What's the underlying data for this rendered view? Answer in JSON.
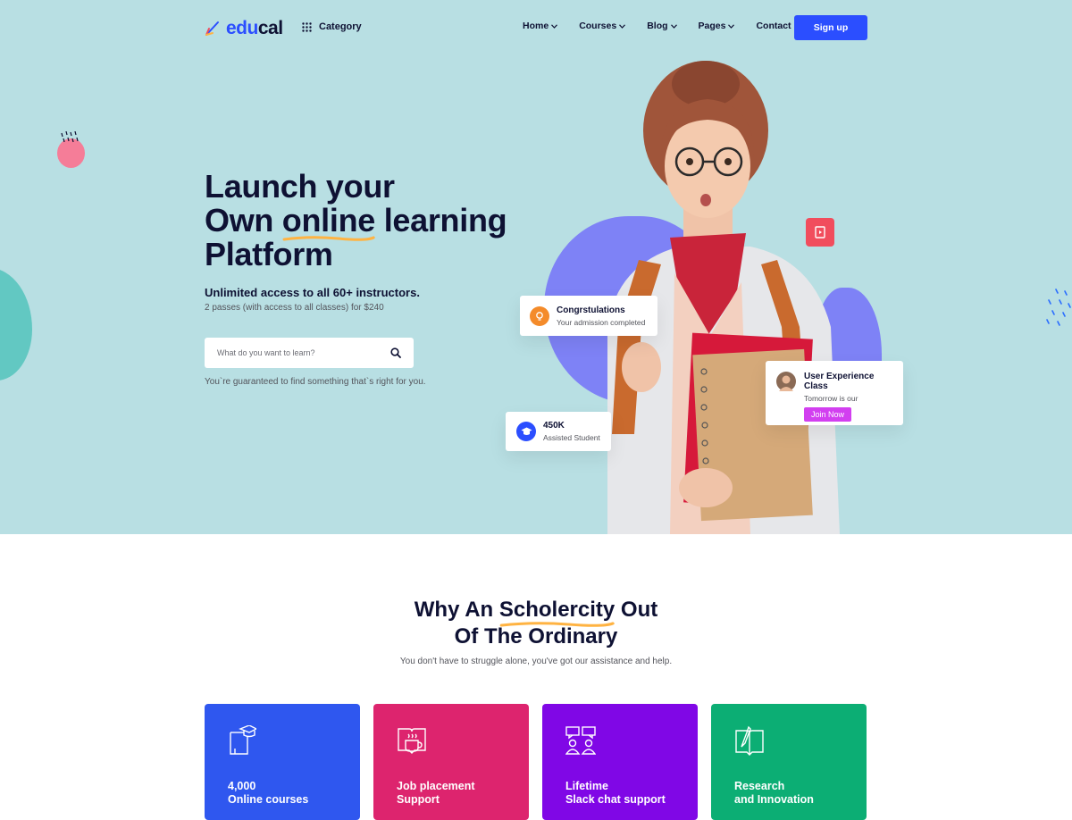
{
  "header": {
    "logo_part1": "edu",
    "logo_part2": "cal",
    "category_label": "Category",
    "nav": [
      "Home",
      "Courses",
      "Blog",
      "Pages",
      "Contact"
    ],
    "signup_label": "Sign up"
  },
  "hero": {
    "title_line1": "Launch your",
    "title_own": "Own ",
    "title_highlight": "online",
    "title_rest": " learning",
    "title_line3": "Platform",
    "subtitle": "Unlimited access to all 60+ instructors.",
    "note": "2 passes (with access to all classes) for $240",
    "search_placeholder": "What do you want to learn?",
    "guarantee": "You`re guaranteed to find something that`s right for you."
  },
  "cards": {
    "congrats_title": "Congrstulations",
    "congrats_text": "Your admission completed",
    "ux_title": "User Experience Class",
    "ux_text": "Tomorrow is our",
    "ux_button": "Join Now",
    "students_count": "450K",
    "students_text": "Assisted Student"
  },
  "why": {
    "title_pre": "Why An ",
    "title_highlight": "Scholercity",
    "title_post": " Out",
    "title_line2": "Of The Ordinary",
    "subtitle": "You don't have to struggle alone, you've got our assistance and help."
  },
  "features": [
    {
      "title": "4,000\nOnline courses",
      "color": "#2f57ef",
      "icon": "graduation-book-icon"
    },
    {
      "title": "Job placement\nSupport",
      "color": "#dd246e",
      "icon": "coffee-book-icon"
    },
    {
      "title": "Lifetime\nSlack chat support",
      "color": "#8007e6",
      "icon": "chat-users-icon"
    },
    {
      "title": "Research\nand Innovation",
      "color": "#0cae74",
      "icon": "pen-book-icon"
    }
  ],
  "colors": {
    "hero_bg": "#b8dfe3",
    "primary": "#2b4eff",
    "highlight_underline": "#ffb342"
  }
}
